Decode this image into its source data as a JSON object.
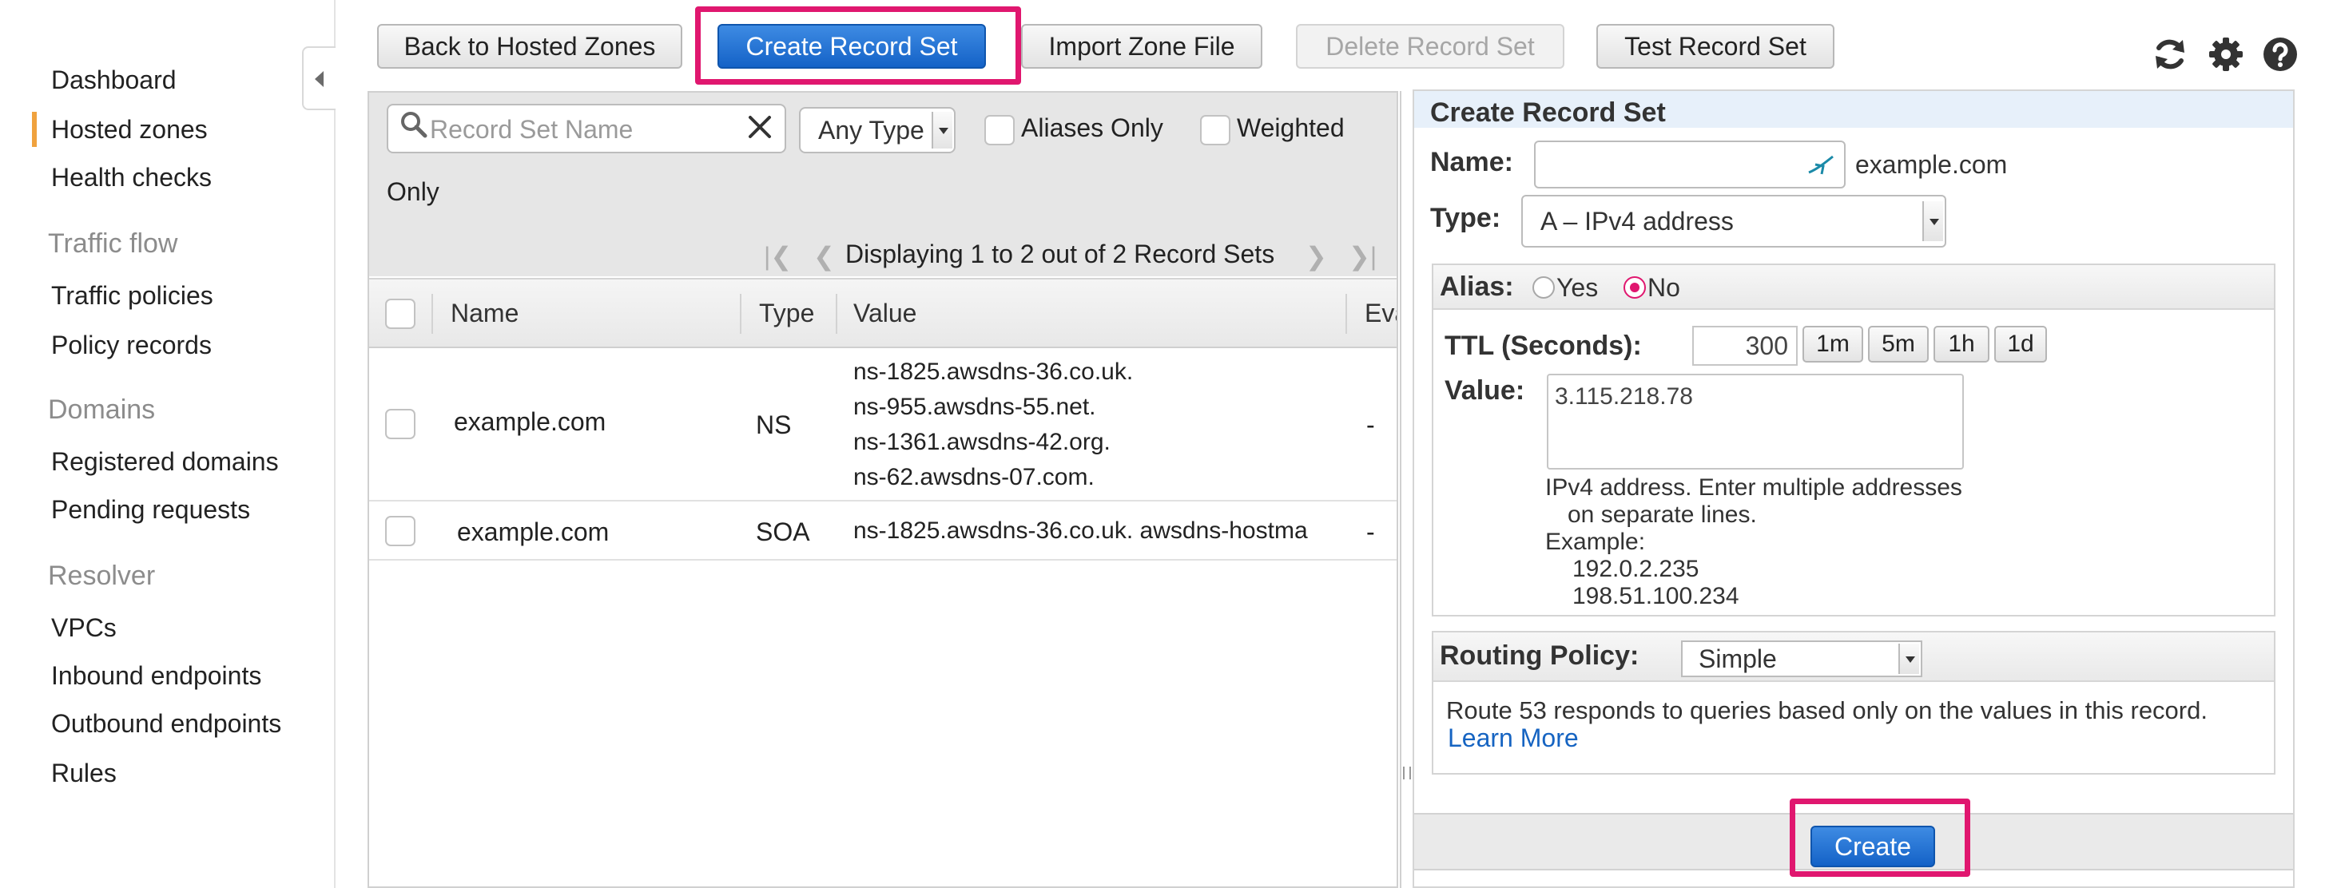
{
  "sidebar": {
    "items": [
      {
        "label": "Dashboard"
      },
      {
        "label": "Hosted zones"
      },
      {
        "label": "Health checks"
      },
      {
        "label": "Traffic policies"
      },
      {
        "label": "Policy records"
      },
      {
        "label": "Registered domains"
      },
      {
        "label": "Pending requests"
      },
      {
        "label": "VPCs"
      },
      {
        "label": "Inbound endpoints"
      },
      {
        "label": "Outbound endpoints"
      },
      {
        "label": "Rules"
      }
    ],
    "sections": [
      {
        "label": "Traffic flow"
      },
      {
        "label": "Domains"
      },
      {
        "label": "Resolver"
      }
    ],
    "active_item": "Hosted zones",
    "active_color": "#f0a23e"
  },
  "toolbar": {
    "back_label": "Back to Hosted Zones",
    "create_label": "Create Record Set",
    "import_label": "Import Zone File",
    "delete_label": "Delete Record Set",
    "test_label": "Test Record Set",
    "icons": [
      "refresh-icon",
      "gear-icon",
      "help-icon"
    ],
    "highlight_color": "#e0176f"
  },
  "filters": {
    "search_placeholder": "Record Set Name",
    "type_value": "Any Type",
    "aliases_label": "Aliases Only",
    "weighted_label": "Weighted",
    "weighted_wrap": "Only"
  },
  "pager": {
    "text": "Displaying 1 to 2 out of 2 Record Sets"
  },
  "table": {
    "columns": [
      "Name",
      "Type",
      "Value",
      "Eva"
    ],
    "rows": [
      {
        "name": "example.com",
        "type": "NS",
        "values": [
          "ns-1825.awsdns-36.co.uk.",
          "ns-955.awsdns-55.net.",
          "ns-1361.awsdns-42.org.",
          "ns-62.awsdns-07.com."
        ],
        "eval": "-"
      },
      {
        "name": "example.com",
        "type": "SOA",
        "values": [
          "ns-1825.awsdns-36.co.uk. awsdns-hostma"
        ],
        "eval": "-"
      }
    ]
  },
  "create_panel": {
    "title": "Create Record Set",
    "name_label": "Name:",
    "name_value": "",
    "name_suffix": "example.com",
    "type_label": "Type:",
    "type_value": "A – IPv4 address",
    "alias_label": "Alias:",
    "alias_yes": "Yes",
    "alias_no": "No",
    "alias_selected": "No",
    "ttl_label": "TTL (Seconds):",
    "ttl_value": "300",
    "ttl_buttons": [
      "1m",
      "5m",
      "1h",
      "1d"
    ],
    "value_label": "Value:",
    "value_text": "3.115.218.78",
    "value_help": [
      "IPv4 address. Enter multiple addresses",
      "on separate lines.",
      "Example:",
      "192.0.2.235",
      "198.51.100.234"
    ],
    "routing_label": "Routing Policy:",
    "routing_value": "Simple",
    "routing_desc": "Route 53 responds to queries based only on the values in this record.",
    "learn_more": "Learn More",
    "create_button": "Create",
    "header_bg": "#e7f0fa",
    "button_color": "#1a6fd6"
  }
}
